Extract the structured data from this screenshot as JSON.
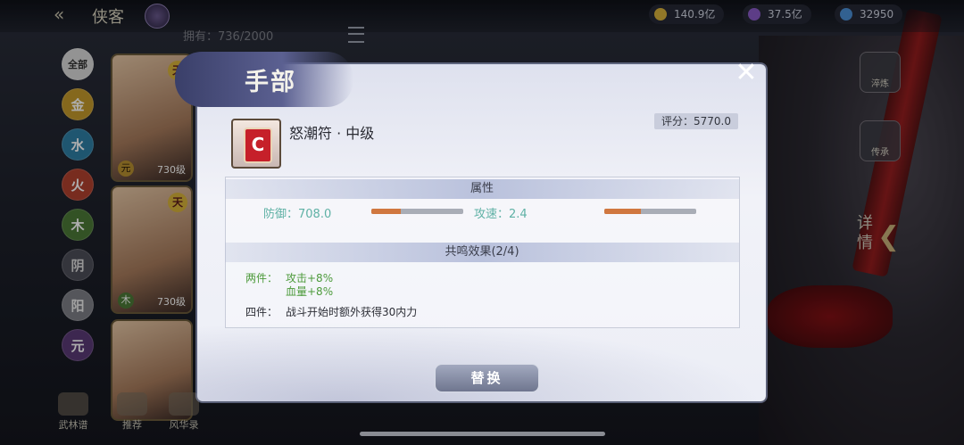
{
  "header": {
    "back_icon": "double-arrow-left-icon",
    "title": "侠客",
    "owned_text": "拥有：736/2000",
    "resources": [
      {
        "icon": "gold-coin-icon",
        "value": "140.9亿",
        "color": "#d8b23b"
      },
      {
        "icon": "purple-orb-icon",
        "value": "37.5亿",
        "color": "#8a5bc7"
      },
      {
        "icon": "blue-gem-icon",
        "value": "32950",
        "color": "#4b8fd6"
      }
    ]
  },
  "filters": [
    {
      "label": "全部",
      "color": "#d9d9d9",
      "text": "#333"
    },
    {
      "label": "金",
      "color": "#c59a2b",
      "text": "#fff"
    },
    {
      "label": "水",
      "color": "#2f7fa6",
      "text": "#fff"
    },
    {
      "label": "火",
      "color": "#b2412e",
      "text": "#fff"
    },
    {
      "label": "木",
      "color": "#4c7a37",
      "text": "#fff"
    },
    {
      "label": "阴",
      "color": "#4d4e59",
      "text": "#ddd"
    },
    {
      "label": "阳",
      "color": "#7e7f86",
      "text": "#eee"
    },
    {
      "label": "元",
      "color": "#5b3a76",
      "text": "#fff"
    }
  ],
  "cards": [
    {
      "tag": "天",
      "element": "元",
      "level": "730级"
    },
    {
      "tag": "天",
      "element": "木",
      "level": "730级"
    },
    {
      "tag": "",
      "element": "",
      "level": ""
    }
  ],
  "bottom_nav": [
    {
      "label": "武林谱"
    },
    {
      "label": "推荐"
    },
    {
      "label": "风华录"
    }
  ],
  "right_buttons": [
    {
      "label": "淬炼"
    },
    {
      "label": "传承"
    }
  ],
  "detail_label": "详情",
  "dialog": {
    "title": "手部",
    "close_icon": "close-icon",
    "item_name": "怒潮符 · 中级",
    "item_icon": "scroll-icon",
    "score": "评分：5770.0",
    "attributes_header": "属性",
    "attributes": [
      {
        "label": "防御：708.0",
        "level": 0.32
      },
      {
        "label": "攻速：2.4",
        "level": 0.4
      }
    ],
    "resonance_header": "共鸣效果(2/4)",
    "resonance": [
      {
        "tier": "两件：",
        "effects": [
          "攻击+8%",
          "血量+8%"
        ]
      },
      {
        "tier": "四件：",
        "effects": [
          "战斗开始时额外获得30内力"
        ]
      }
    ],
    "replace_button": "替换"
  }
}
